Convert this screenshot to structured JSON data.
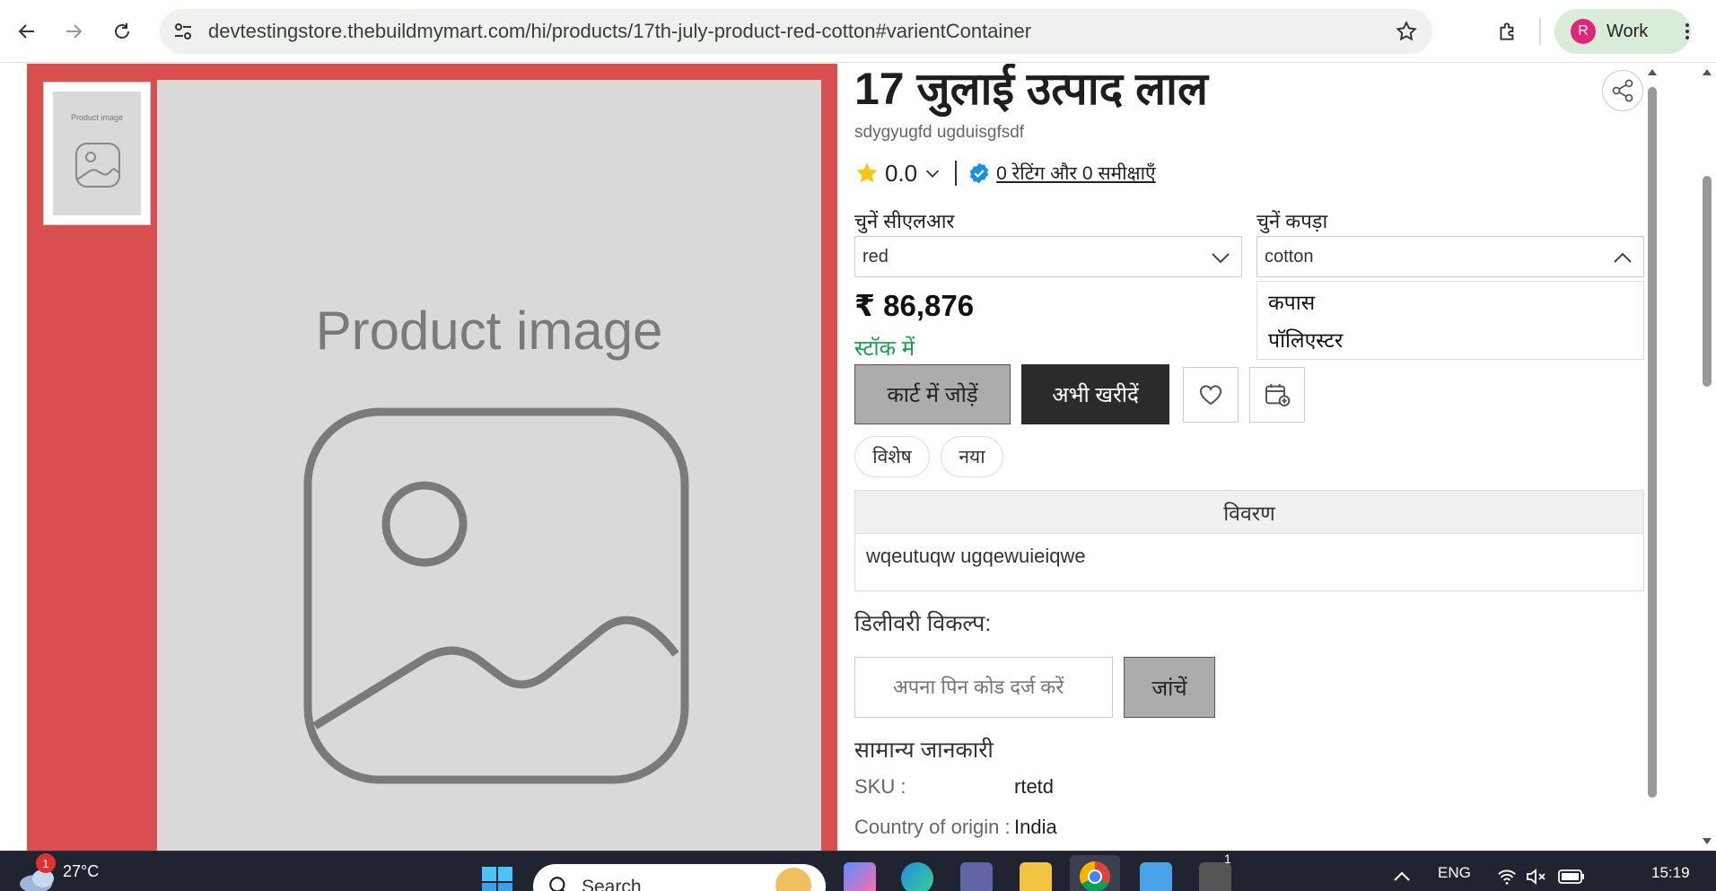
{
  "browser": {
    "url": "devtestingstore.thebuildmymart.com/hi/products/17th-july-product-red-cotton#varientContainer",
    "profile_initial": "R",
    "profile_name": "Work"
  },
  "gallery": {
    "thumb_label": "Product image",
    "main_label": "Product image"
  },
  "product": {
    "title": "17 जुलाई उत्पाद लाल",
    "subtitle": "sdygyugfd ugduisgfsdf",
    "rating_value": "0.0",
    "reviews_link": "0 रेटिंग और 0 समीक्षाएँ",
    "color_label": "चुनें सीएलआर",
    "color_value": "red",
    "fabric_label": "चुनें कपड़ा",
    "fabric_value": "cotton",
    "fabric_options": [
      "कपास",
      "पॉलिएस्टर"
    ],
    "price": "₹ 86,876",
    "stock": "स्टॉक में",
    "add_to_cart": "कार्ट में जोड़ें",
    "buy_now": "अभी खरीदें",
    "tags": [
      "विशेष",
      "नया"
    ],
    "description_heading": "विवरण",
    "description": "wqeutuqw ugqewuieiqwe",
    "delivery_heading": "डिलीवरी विकल्प:",
    "pincode_placeholder": "अपना पिन कोड दर्ज करें",
    "check_button": "जांचें",
    "general_info_heading": "सामान्य जानकारी",
    "info": [
      {
        "key": "SKU :",
        "value": "rtetd"
      },
      {
        "key": "Country of origin :",
        "value": "India"
      }
    ]
  },
  "taskbar": {
    "notification_count": "1",
    "temperature": "27°C",
    "search_label": "Search",
    "app_badge": "1",
    "language": "ENG",
    "time": "15:19"
  },
  "colors": {
    "gallery_bg": "#d94f50",
    "in_stock": "#15a049",
    "buy_button": "#2b2b2b",
    "rating_star": "#f5c518",
    "verified": "#1a8fe0"
  }
}
